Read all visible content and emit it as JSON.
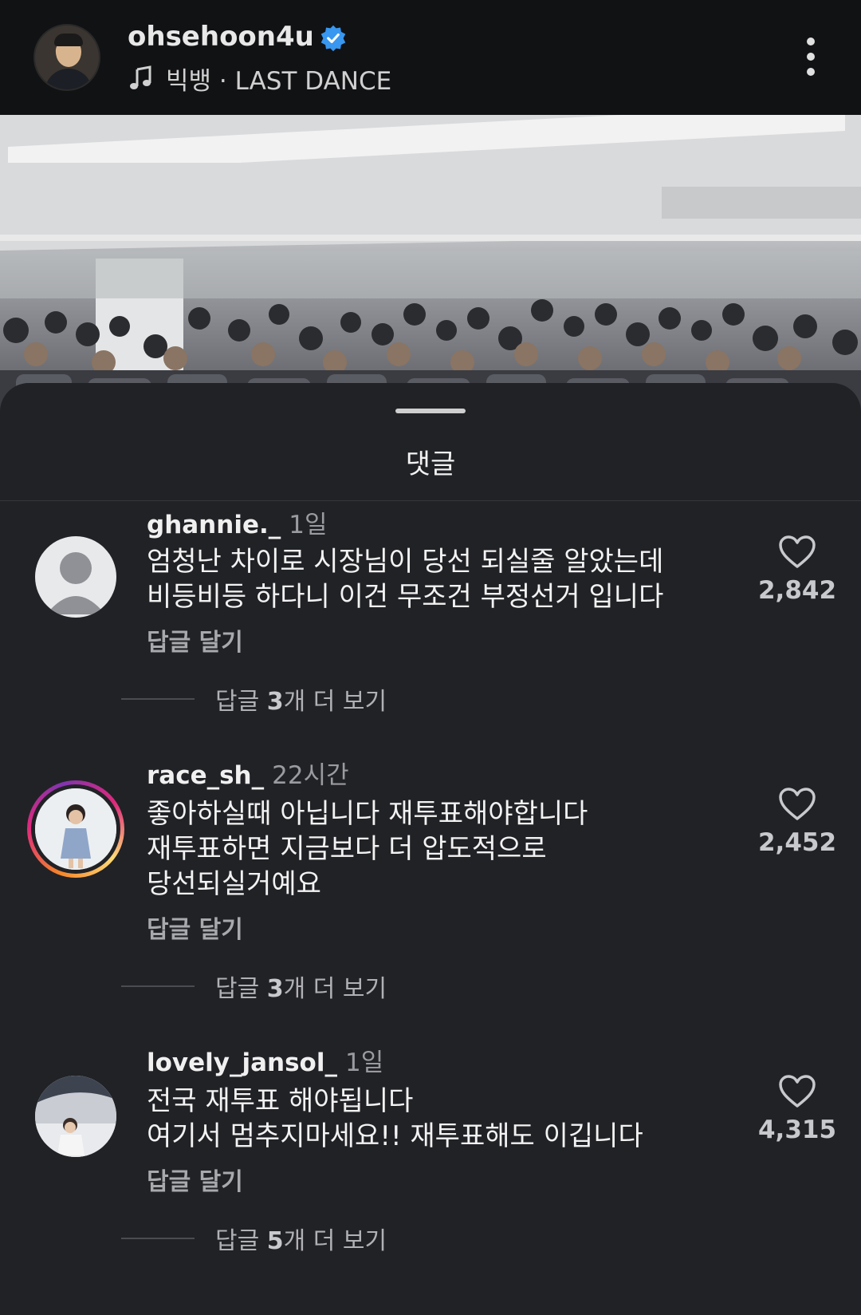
{
  "header": {
    "username": "ohsehoon4u",
    "music": "빅뱅 · LAST DANCE"
  },
  "sheet": {
    "title": "댓글"
  },
  "comments": [
    {
      "user": "ghannie._",
      "time": "1일",
      "text": "엄청난 차이로 시장님이 당선 되실줄 알았는데\n비등비등 하다니 이건 무조건 부정선거 입니다",
      "reply_label": "답글 달기",
      "likes": "2,842",
      "more_prefix": "답글 ",
      "more_count": "3",
      "more_suffix": "개 더 보기"
    },
    {
      "user": "race_sh_",
      "time": "22시간",
      "text": "좋아하실때 아닙니다 재투표해야합니다\n재투표하면 지금보다 더 압도적으로\n당선되실거예요",
      "reply_label": "답글 달기",
      "likes": "2,452",
      "more_prefix": "답글 ",
      "more_count": "3",
      "more_suffix": "개 더 보기"
    },
    {
      "user": "lovely_jansol_",
      "time": "1일",
      "text": "전국 재투표 해야됩니다\n여기서 멈추지마세요!! 재투표해도 이깁니다",
      "reply_label": "답글 달기",
      "likes": "4,315",
      "more_prefix": "답글 ",
      "more_count": "5",
      "more_suffix": "개 더 보기"
    }
  ]
}
